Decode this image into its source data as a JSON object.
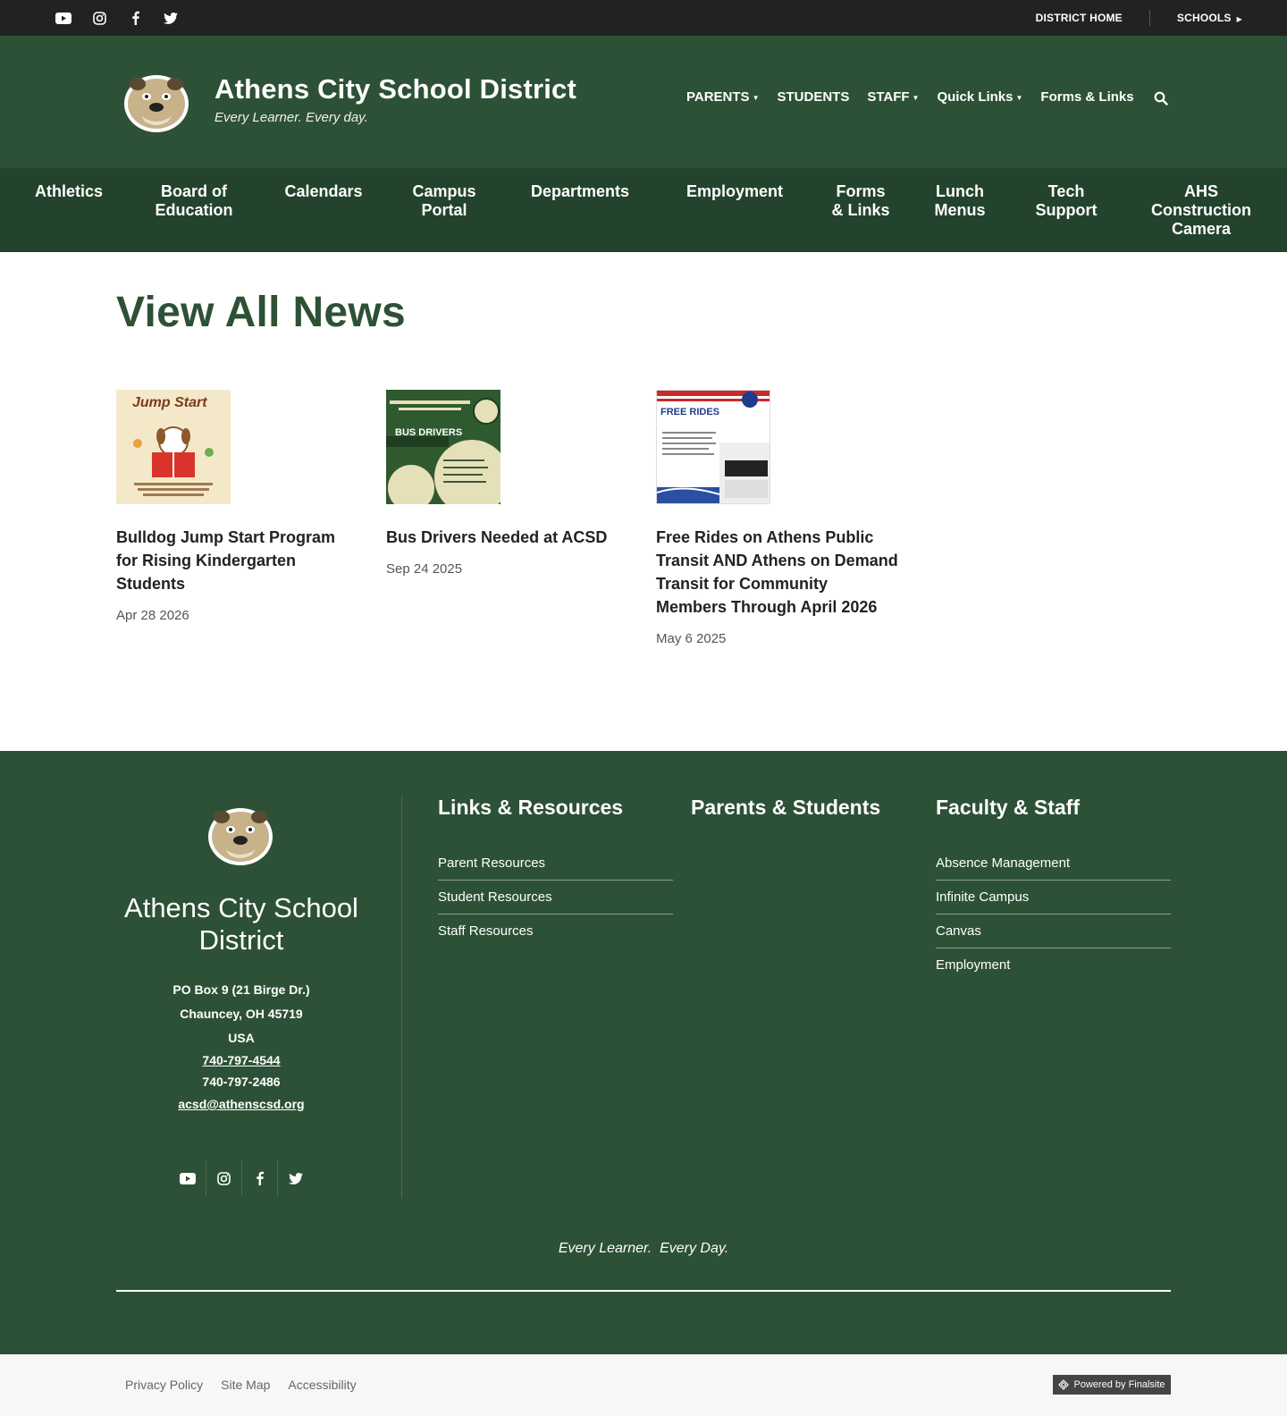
{
  "utility": {
    "social": [
      "youtube-icon",
      "instagram-icon",
      "facebook-icon",
      "twitter-icon"
    ],
    "district_home": "DISTRICT HOME",
    "schools": "SCHOOLS"
  },
  "header": {
    "title": "Athens City School District",
    "tagline": "Every Learner. Every day.",
    "nav": [
      {
        "label": "PARENTS",
        "dropdown": true
      },
      {
        "label": "STUDENTS",
        "dropdown": false
      },
      {
        "label": "STAFF",
        "dropdown": true
      },
      {
        "label": "Quick Links",
        "dropdown": true
      },
      {
        "label": "Forms & Links",
        "dropdown": false
      }
    ]
  },
  "mainnav": {
    "items": [
      {
        "label": "Athletics"
      },
      {
        "label": "Board of Education"
      },
      {
        "label": "Calendars"
      },
      {
        "label": "Campus Portal"
      },
      {
        "label": "Departments"
      },
      {
        "label": "Employment"
      },
      {
        "label": "Forms & Links"
      },
      {
        "label": "Lunch Menus"
      },
      {
        "label": "Tech Support"
      },
      {
        "label": "AHS Construction Camera"
      }
    ]
  },
  "main": {
    "title": "View All News",
    "news": [
      {
        "title": "Bulldog Jump Start Program for Rising Kindergarten Students",
        "date": "Apr 28 2026",
        "thumb_text": "Jump Start"
      },
      {
        "title": "Bus Drivers Needed at ACSD",
        "date": "Sep 24 2025",
        "thumb_text": "BUS DRIVERS"
      },
      {
        "title": "Free Rides on Athens Public Transit AND Athens on Demand Transit for Community Members Through April 2026",
        "date": "May 6 2025",
        "thumb_text": "FREE RIDES"
      }
    ]
  },
  "footer": {
    "name": "Athens City School District",
    "address1": "PO Box 9 (21 Birge Dr.)",
    "address2": "Chauncey, OH  45719",
    "country": "USA",
    "phone": "740-797-4544",
    "fax": "740-797-2486",
    "email": "acsd@athenscsd.org",
    "columns": [
      {
        "heading": "Links & Resources",
        "links": [
          "Parent Resources",
          "Student Resources",
          "Staff Resources"
        ]
      },
      {
        "heading": "Parents & Students",
        "links": []
      },
      {
        "heading": "Faculty & Staff",
        "links": [
          "Absence Management",
          "Infinite Campus",
          "Canvas",
          "Employment"
        ]
      }
    ],
    "tagline": "Every Learner.  Every Day."
  },
  "bottom": {
    "links": [
      "Privacy Policy",
      "Site Map",
      "Accessibility"
    ],
    "powered": "Powered by Finalsite"
  },
  "colors": {
    "header_green": "#2d5136",
    "nav_green": "#24432c",
    "utility_dark": "#222222"
  }
}
